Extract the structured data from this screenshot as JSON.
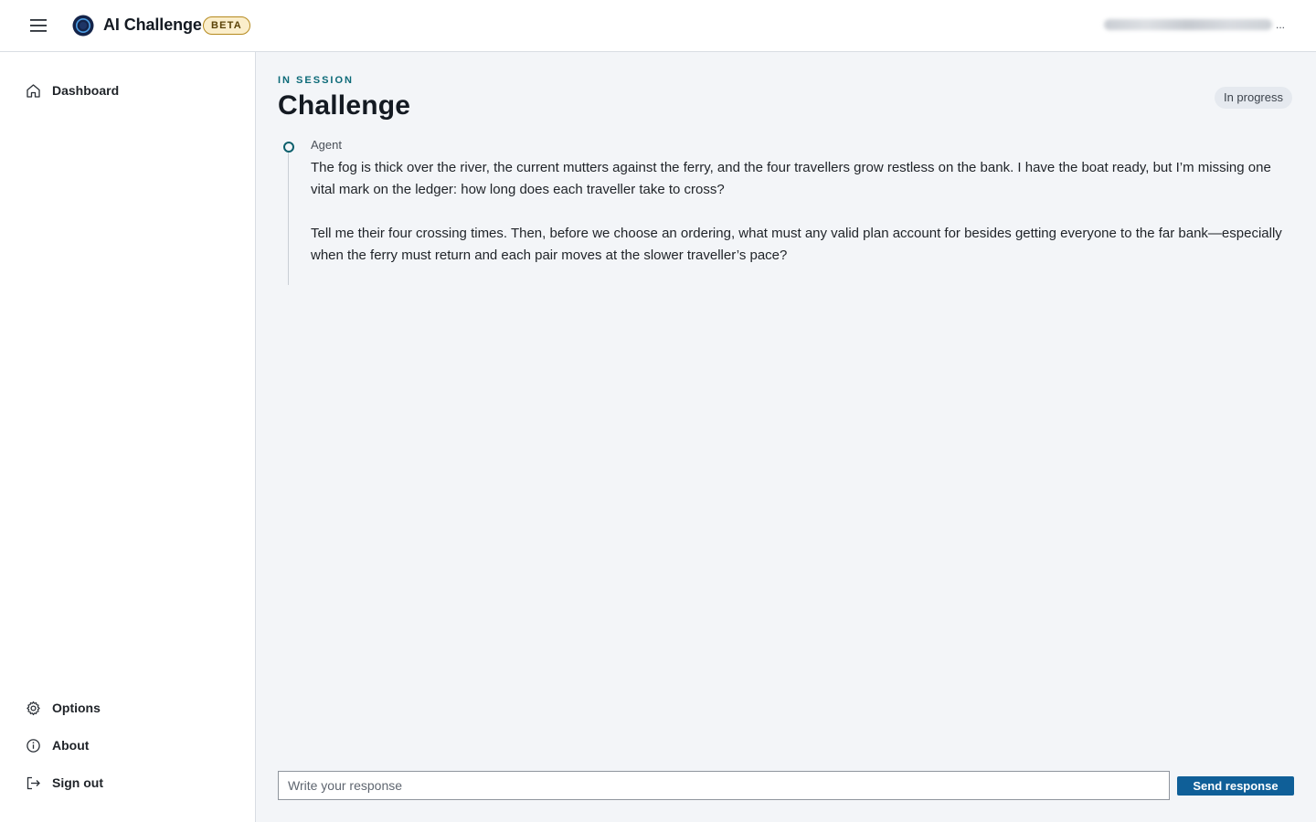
{
  "header": {
    "brand_name": "AI Challenge",
    "beta_label": "BETA",
    "user_overflow": "..."
  },
  "sidebar": {
    "top_items": [
      {
        "label": "Dashboard",
        "icon": "home-icon"
      }
    ],
    "bottom_items": [
      {
        "label": "Options",
        "icon": "gear-icon"
      },
      {
        "label": "About",
        "icon": "info-icon"
      },
      {
        "label": "Sign out",
        "icon": "sign-out-icon"
      }
    ]
  },
  "main": {
    "eyebrow": "IN SESSION",
    "title": "Challenge",
    "status": "In progress",
    "messages": [
      {
        "author": "Agent",
        "paragraphs": [
          "The fog is thick over the river, the current mutters against the ferry, and the four travellers grow restless on the bank. I have the boat ready, but I’m missing one vital mark on the ledger: how long does each traveller take to cross?",
          "Tell me their four crossing times. Then, before we choose an ordering, what must any valid plan account for besides getting everyone to the far bank—especially when the ferry must return and each pair moves at the slower traveller’s pace?"
        ]
      }
    ]
  },
  "composer": {
    "placeholder": "Write your response",
    "value": "",
    "send_label": "Send response"
  },
  "colors": {
    "accent_teal": "#0c6a78",
    "primary_button": "#0f5f98",
    "beta_bg": "#fbeecb",
    "page_bg": "#f3f5f8"
  }
}
